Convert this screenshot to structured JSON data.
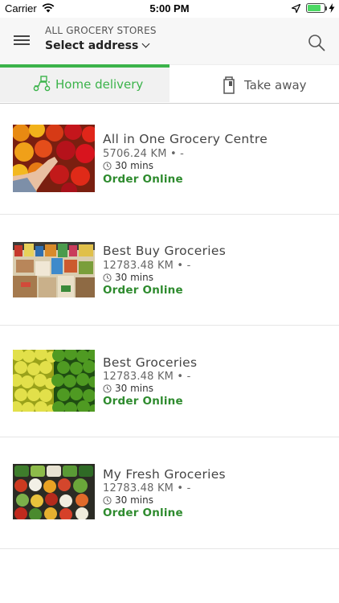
{
  "status_bar": {
    "carrier": "Carrier",
    "time": "5:00 PM",
    "icons": [
      "wifi-icon",
      "location-arrow-icon",
      "battery-icon",
      "charging-bolt-icon"
    ],
    "battery_color": "#4cd964"
  },
  "header": {
    "store_label": "ALL GROCERY STORES",
    "address_label": "Select address",
    "icons": [
      "menu-icon",
      "chevron-down-icon",
      "search-icon"
    ]
  },
  "tabs": [
    {
      "label": "Home delivery",
      "active": true,
      "icon": "delivery-scooter-icon"
    },
    {
      "label": "Take away",
      "active": false,
      "icon": "takeaway-bag-icon"
    }
  ],
  "colors": {
    "accent": "#3bb34a",
    "order_link": "#2e8b2e"
  },
  "stores": [
    {
      "name": "All in One Grocery Centre",
      "distance": "5706.24 KM • -",
      "time": "30 mins",
      "action": "Order Online",
      "image": "peppers-photo"
    },
    {
      "name": "Best Buy Groceries",
      "distance": "12783.48 KM • -",
      "time": "30 mins",
      "action": "Order Online",
      "image": "grocery-shelf-photo"
    },
    {
      "name": "Best Groceries",
      "distance": "12783.48 KM • -",
      "time": "30 mins",
      "action": "Order Online",
      "image": "lemons-limes-photo"
    },
    {
      "name": "My Fresh Groceries",
      "distance": "12783.48 KM • -",
      "time": "30 mins",
      "action": "Order Online",
      "image": "vegetable-bowls-photo"
    }
  ]
}
